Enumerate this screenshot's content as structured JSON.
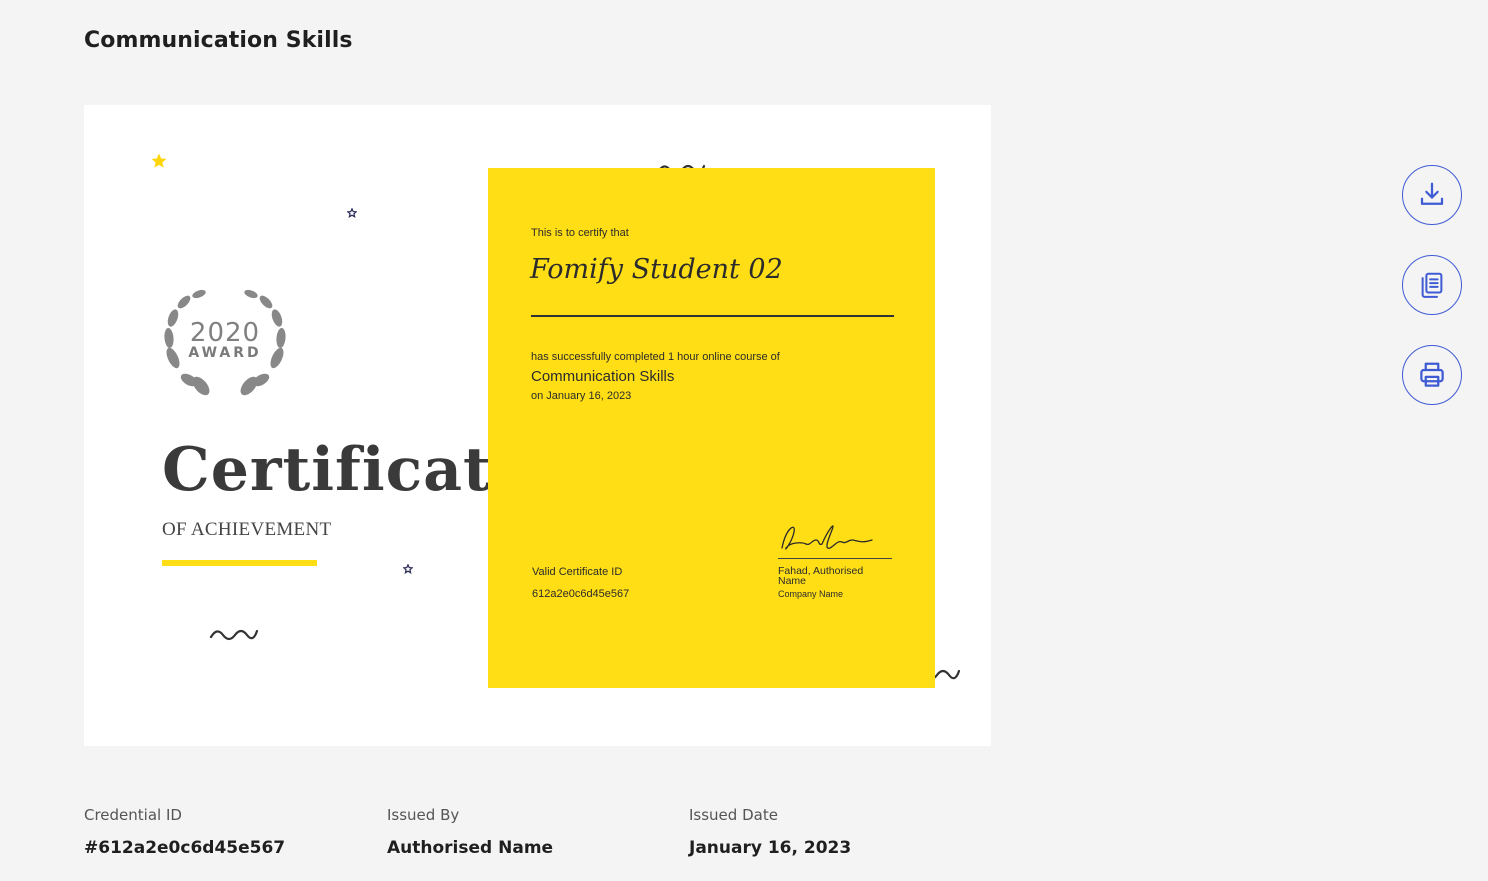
{
  "page": {
    "title": "Communication Skills"
  },
  "certificate": {
    "award_year": "2020",
    "award_word": "AWARD",
    "title": "Certificate",
    "subtitle": "OF ACHIEVEMENT",
    "certify_text": "This is to certify that",
    "student_name": "Fomify Student 02",
    "completed_text": "has successfully completed 1 hour online course of",
    "course_name": "Communication Skills",
    "completion_date": "on January 16, 2023",
    "valid_id_label": "Valid Certificate ID",
    "valid_id": "612a2e0c6d45e567",
    "signer": "Fahad, Authorised Name",
    "company": "Company Name",
    "colors": {
      "accent": "#ffde16",
      "panel_text": "#2b2b2b"
    }
  },
  "actions": [
    {
      "name": "download",
      "icon": "download-icon"
    },
    {
      "name": "copy",
      "icon": "copy-icon"
    },
    {
      "name": "print",
      "icon": "print-icon"
    }
  ],
  "accent_color": "#3f5bd4",
  "meta": {
    "credential": {
      "label": "Credential ID",
      "value": "#612a2e0c6d45e567"
    },
    "issued_by": {
      "label": "Issued By",
      "value": "Authorised Name"
    },
    "issued_date": {
      "label": "Issued Date",
      "value": "January 16, 2023"
    }
  }
}
